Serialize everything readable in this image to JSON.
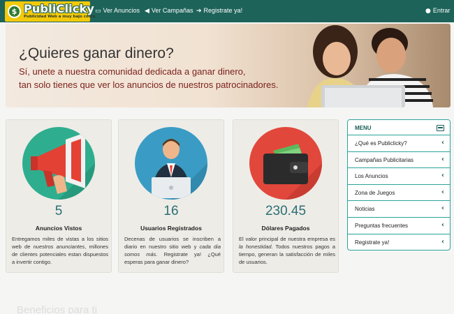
{
  "navbar": {
    "logo": {
      "name": "PubliClicky",
      "tagline": "Publicidad Web a muy bajo costo",
      "coin_symbol": "$"
    },
    "items": [
      {
        "icon": "tv-icon",
        "label": "Ver Anuncios"
      },
      {
        "icon": "megaphone-icon",
        "label": "Ver Campañas"
      },
      {
        "icon": "sign-in-icon",
        "label": "Registrate ya!"
      }
    ],
    "login": {
      "icon": "user-icon",
      "label": "Entrar"
    }
  },
  "hero": {
    "title": "¿Quieres ganar dinero?",
    "line1": "Sí, unete a nuestra comunidad dedicada a ganar dinero,",
    "line2": "tan solo tienes que ver los anuncios de nuestros patrocinadores."
  },
  "stats": [
    {
      "icon": "megaphone-icon",
      "value": "5",
      "label": "Anuncios Vistos",
      "desc": [
        "Entregamos miles de vistas a los sitios web de ",
        {
          "em": "nuestros anunciantes"
        },
        ", millones de clientes potenciales estan dispuestos a invertir contigo."
      ]
    },
    {
      "icon": "user-at-computer-icon",
      "value": "16",
      "label": "Usuarios Registrados",
      "desc": [
        "Decenas de usuarios se inscriben a diario en nuestro sitio web y ",
        {
          "em": "cada dia somos más"
        },
        ". Registrate ya! ¿Qué esperas para ganar dinero?"
      ]
    },
    {
      "icon": "wallet-icon",
      "value": "230.45",
      "label": "Dólares Pagados",
      "desc": [
        "El valor principal de nuestra empresa es ",
        {
          "em": "la honestidad"
        },
        ". Todos nuestros pagos a tiempo, generan la satisfacción de miles de usuarios."
      ]
    }
  ],
  "menu": {
    "title": "MENU",
    "items": [
      "¿Qué es Publiclicky?",
      "Campañas Publicitarias",
      "Los Anuncios",
      "Zona de Juegos",
      "Noticias",
      "Preguntas frecuentes",
      "Registrate ya!"
    ]
  },
  "footer": {
    "title": "Beneficios para ti"
  },
  "colors": {
    "navbar": "#1d6359",
    "logo": "#f2c90b",
    "accent": "#2a6f73",
    "menu_border": "#2aa39a",
    "hero_sub": "#7a1f1a"
  }
}
